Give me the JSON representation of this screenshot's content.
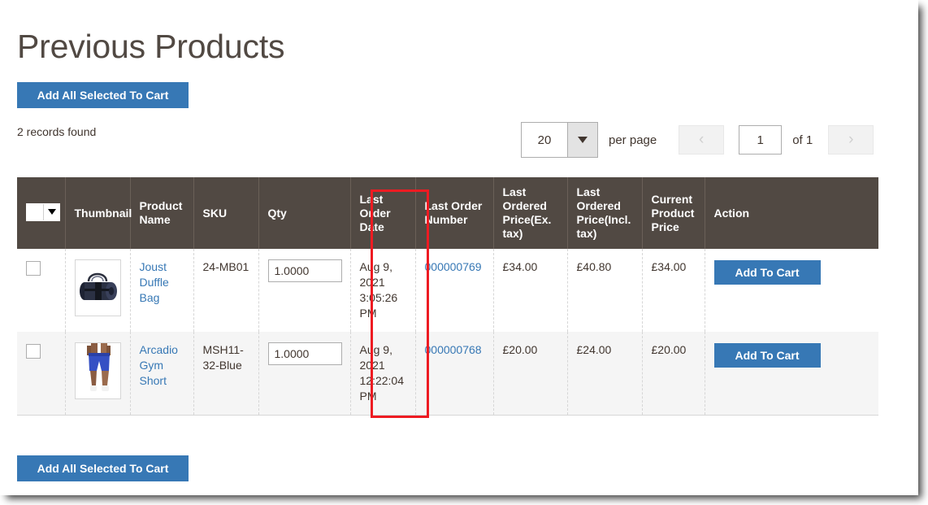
{
  "page": {
    "title": "Previous Products",
    "records_found": "2 records found"
  },
  "buttons": {
    "add_all_selected_top": "Add All Selected To Cart",
    "add_all_selected_bottom": "Add All Selected To Cart"
  },
  "pager": {
    "per_page_value": "20",
    "per_page_label": "per page",
    "prev_icon": "chevron-left-icon",
    "next_icon": "chevron-right-icon",
    "prev_glyph": "‹",
    "next_glyph": "›",
    "current_page": "1",
    "of_label": "of 1",
    "per_page_options": [
      "20"
    ]
  },
  "table": {
    "columns": [
      {
        "key": "select",
        "label": ""
      },
      {
        "key": "thumbnail",
        "label": "Thumbnail"
      },
      {
        "key": "product_name",
        "label": "Product Name"
      },
      {
        "key": "sku",
        "label": "SKU"
      },
      {
        "key": "qty",
        "label": "Qty"
      },
      {
        "key": "last_order_date",
        "label": "Last Order Date"
      },
      {
        "key": "last_order_number",
        "label": "Last Order Number"
      },
      {
        "key": "last_ordered_price_ex",
        "label": "Last Ordered Price(Ex. tax)"
      },
      {
        "key": "last_ordered_price_incl",
        "label": "Last Ordered Price(Incl. tax)"
      },
      {
        "key": "current_product_price",
        "label": "Current Product Price"
      },
      {
        "key": "action",
        "label": "Action"
      }
    ],
    "rows": [
      {
        "product_name": "Joust Duffle Bag",
        "sku": "24-MB01",
        "qty": "1.0000",
        "last_order_date": "Aug 9, 2021 3:05:26 PM",
        "last_order_number": "000000769",
        "last_ordered_price_ex": "£34.00",
        "last_ordered_price_incl": "£40.80",
        "current_product_price": "£34.00",
        "action_label": "Add To Cart",
        "thumbnail_icon": "duffle-bag-thumbnail"
      },
      {
        "product_name": "Arcadio Gym Short",
        "sku": "MSH11-32-Blue",
        "qty": "1.0000",
        "last_order_date": "Aug 9, 2021 12:22:04 PM",
        "last_order_number": "000000768",
        "last_ordered_price_ex": "£20.00",
        "last_ordered_price_incl": "£24.00",
        "current_product_price": "£20.00",
        "action_label": "Add To Cart",
        "thumbnail_icon": "gym-short-thumbnail"
      }
    ]
  },
  "annotation": {
    "highlight_color": "#ee1b22",
    "highlighted_column": "Last Order Date"
  },
  "colors": {
    "accent_blue": "#3778b5",
    "header_brown": "#514943",
    "link_blue": "#3778b5",
    "text": "#41362f"
  }
}
